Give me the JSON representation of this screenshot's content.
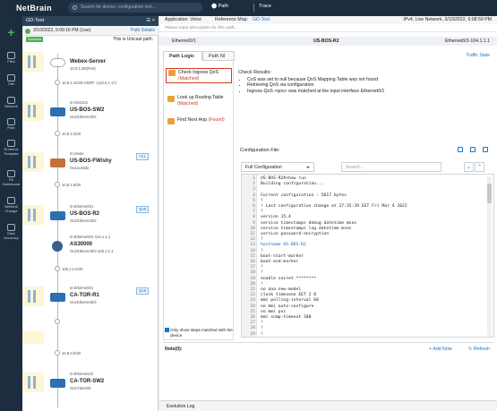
{
  "topbar": {
    "logo": "NetBrain",
    "search_placeholder": "Search for device, configuration text...",
    "path_label": "Path",
    "trace_label": "Trace"
  },
  "leftnav": [
    {
      "label": "Files",
      "icon": "folder-icon"
    },
    {
      "label": "Site",
      "icon": "site-icon"
    },
    {
      "label": "Network",
      "icon": "network-icon"
    },
    {
      "label": "Path",
      "icon": "path-icon"
    },
    {
      "label": "Runbook Template",
      "icon": "runbook-icon"
    },
    {
      "label": "PA Dashboard",
      "icon": "dashboard-icon"
    },
    {
      "label": "Network Change",
      "icon": "change-icon"
    },
    {
      "label": "Data Accuracy",
      "icon": "accuracy-icon"
    }
  ],
  "path_panel": {
    "title": "GD-Test",
    "date": "3/10/2022, 6:09:16 PM (Live)",
    "details_link": "Path Details",
    "status_badge": "Success",
    "status_text": "This is Unicast path.",
    "hops": [
      {
        "name": "Webex-Server",
        "sub": "10.8.1.26(IPv4)"
      },
      {
        "link": "10.8.1.16/28  HSRP: 1(10.8.1.17)"
      },
      {
        "in": "In:Vlan101",
        "name": "US-BOS-SW2",
        "sub": "Out:Ethernet0/2"
      },
      {
        "link": "10.8.1.0/29"
      },
      {
        "in": "In:inside",
        "name": "US-BOS-FW/shy",
        "sub": "Out:outside",
        "tag": "ACL"
      },
      {
        "link": "10.8.1.8/29"
      },
      {
        "in": "In:Ethernet0/1",
        "name": "US-BOS-R2",
        "sub": "Out:Ethernet0/2",
        "tag": "QoS"
      },
      {
        "link": "In:Ethernet0/2-104.1.1.1"
      },
      {
        "name": "AS30000",
        "sub": "Out:Ethernet0/3-105.1.1.1"
      },
      {
        "link": "105.1.1.0/30"
      },
      {
        "in": "In:Ethernet0/1",
        "name": "CA-TOR-R1",
        "sub": "Out:Ethernet0/3",
        "tag": "QoS"
      },
      {
        "link": "10.8.3.0/30"
      },
      {
        "in": "In:Ethernet1/0",
        "name": "CA-TOR-SW2",
        "sub": "Out:Vlan300"
      }
    ]
  },
  "main": {
    "app_label": "Application: Voice",
    "ref_map": "Reference Map:",
    "ref_map_link": "GD-Test",
    "ipv4_text": "IPv4, Live Network, 3/10/2022, 6:08:59 PM",
    "desc_placeholder": "Please input description for this path...",
    "hop_left": "Ethernet0/1",
    "hop_device": "US-BOS-R2",
    "hop_right": "Ethernet0/2-104.1.1.1",
    "tabs": [
      "Path Logic",
      "Path NI"
    ],
    "traffic_state": "Traffic State",
    "steps": [
      {
        "label": "Check Ingress QoS",
        "matched": "(Matched)"
      },
      {
        "label": "Look up Routing Table",
        "matched": "(Matched)"
      },
      {
        "label": "Find Next Hop",
        "matched": "(Found)"
      }
    ],
    "only_show_steps": "Only show steps matched with the device",
    "check_results_title": "Check Results:",
    "check_results": [
      "CoS was set to null because QoS Mapping Table was not found",
      "Retrieving QoS via configuration",
      "Ingress QoS <qos> was matched at the input interface Ethernet0/1"
    ],
    "config_title": "Configuration File:",
    "config_select": "Full Configuration",
    "config_search_placeholder": "Search...",
    "config_lines": [
      "US-BOS-R2#show run",
      "Building configuration...",
      "",
      "Current configuration : 5017 bytes",
      "!",
      "! Last configuration change at 17:35:39 EET Fri Mar 4 2022",
      "!",
      "version 15.4",
      "service timestamps debug datetime msec",
      "service timestamps log datetime msec",
      "service password-encryption",
      "!",
      "hostname US-BOS-R2",
      "!",
      "boot-start-marker",
      "boot-end-marker",
      "!",
      "!",
      "enable secret ********",
      "!",
      "no aaa new-model",
      "clock timezone EET 2 0",
      "mmi polling-interval 60",
      "no mmi auto-configure",
      "no mmi pvc",
      "mmi snmp-timeout 180",
      "!",
      "!",
      "!"
    ],
    "note_label": "Note(0):",
    "add_note": "+ Add Note",
    "refresh": "Refresh",
    "exec_log": "Exelution Log"
  },
  "colors": {
    "nav_bg": "#1c2d3f",
    "accent": "#1a73c8",
    "matched": "#d23a20",
    "success": "#4caf50"
  }
}
